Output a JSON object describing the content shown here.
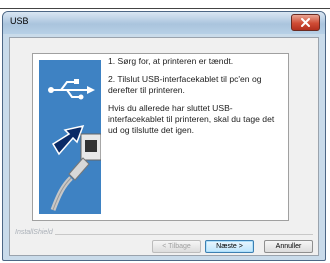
{
  "window": {
    "title": "USB",
    "close_icon": "close-icon"
  },
  "instructions": [
    "1. Sørg for, at printeren er tændt.",
    "2. Tilslut USB-interfacekablet til pc'en og derefter til printeren.",
    "Hvis du allerede har sluttet USB-interfacekablet til printeren, skal du tage det ud og tilslutte det igen."
  ],
  "illustration": {
    "usb_symbol_icon": "usb-icon",
    "arrow_icon": "arrow-right-icon",
    "plug_icon": "usb-plug-icon"
  },
  "footer": {
    "label": "InstallShield"
  },
  "buttons": {
    "back": "< Tilbage",
    "next": "Næste >",
    "cancel": "Annuller"
  },
  "colors": {
    "illustration_bg": "#3e82c3",
    "close_button": "#cf4c35",
    "primary_button_border": "#3c7fb1"
  }
}
